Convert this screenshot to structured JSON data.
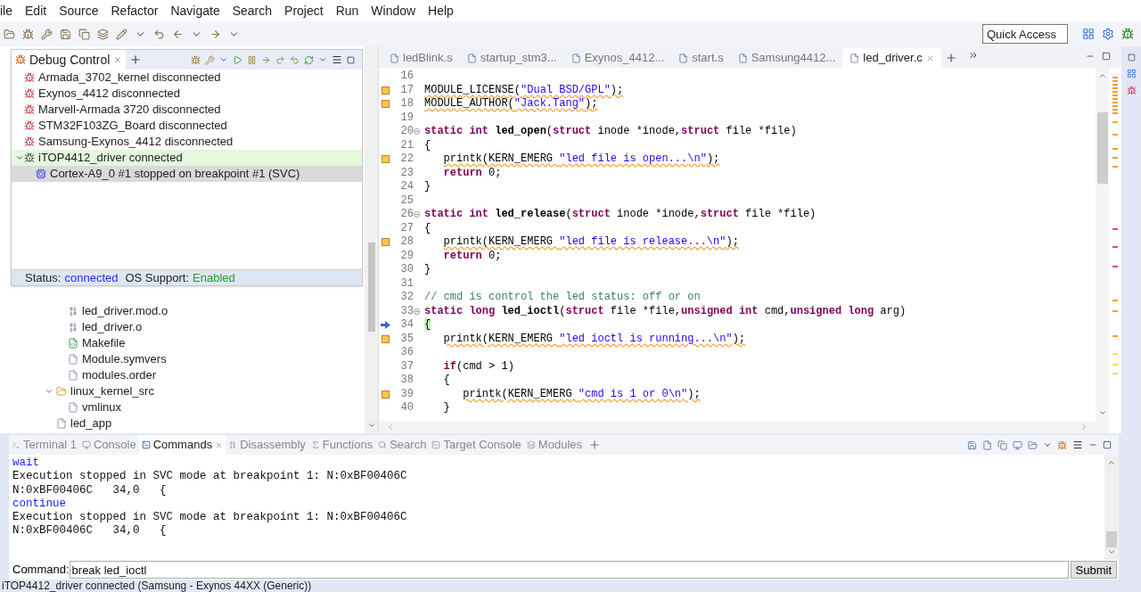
{
  "menu_bar": [
    "ile",
    "Edit",
    "Source",
    "Refactor",
    "Navigate",
    "Search",
    "Project",
    "Run",
    "Window",
    "Help"
  ],
  "quick_access": {
    "placeholder": "Quick Access"
  },
  "debug_control": {
    "tab": {
      "label": "Debug Control",
      "selected": true
    },
    "targets": [
      {
        "label": "Armada_3702_kernel disconnected",
        "connected": false
      },
      {
        "label": "Exynos_4412 disconnected",
        "connected": false
      },
      {
        "label": "Marvell-Armada 3720 disconnected",
        "connected": false
      },
      {
        "label": "STM32F103ZG_Board disconnected",
        "connected": false
      },
      {
        "label": "Samsung-Exynos_4412 disconnected",
        "connected": false
      },
      {
        "label": "iTOP4412_driver connected",
        "connected": true,
        "expanded": true,
        "children": [
          {
            "label": "Cortex-A9_0 #1 stopped on breakpoint #1 (SVC)",
            "selected": true
          }
        ]
      }
    ],
    "status": {
      "label": "Status:",
      "value": "connected",
      "os_label": "OS Support:",
      "os_value": "Enabled"
    }
  },
  "project_tree": [
    {
      "children": [
        {
          "label": "led_driver.mod.o",
          "kind": "object"
        },
        {
          "label": "led_driver.o",
          "kind": "object"
        },
        {
          "label": "Makefile",
          "kind": "makefile"
        },
        {
          "label": "Module.symvers",
          "kind": "file"
        },
        {
          "label": "modules.order",
          "kind": "file"
        }
      ]
    },
    {
      "label": "linux_kernel_src",
      "kind": "folder",
      "expanded": true,
      "children": [
        {
          "label": "vmlinux",
          "kind": "file"
        }
      ]
    },
    {
      "label": "led_app",
      "kind": "file"
    }
  ],
  "editor_tabs": [
    {
      "label": "ledBlink.s",
      "selected": false
    },
    {
      "label": "startup_stm3...",
      "selected": false
    },
    {
      "label": "Exynos_4412...",
      "selected": false
    },
    {
      "label": "start.s",
      "selected": false
    },
    {
      "label": "Samsung4412...",
      "selected": false
    },
    {
      "label": "led_driver.c",
      "selected": true
    }
  ],
  "code_lines": [
    {
      "number": "16"
    },
    {
      "number": "17",
      "warning": true,
      "segments": [
        {
          "kind": "plain",
          "text": "MODULE_LICENSE("
        },
        {
          "kind": "string",
          "text": "\"Dual BSD/GPL\""
        },
        {
          "kind": "plain",
          "text": ");"
        }
      ]
    },
    {
      "number": "18",
      "warning": true,
      "segments": [
        {
          "kind": "plain",
          "text": "MODULE_AUTHOR("
        },
        {
          "kind": "string",
          "text": "\"Jack.Tang\""
        },
        {
          "kind": "plain",
          "text": ");"
        }
      ]
    },
    {
      "number": "19"
    },
    {
      "number": "20",
      "fold": true,
      "segments": [
        {
          "kind": "keyword",
          "text": "static int"
        },
        {
          "kind": "function",
          "text": " led_open"
        },
        {
          "kind": "plain",
          "text": "("
        },
        {
          "kind": "keyword",
          "text": "struct"
        },
        {
          "kind": "plain",
          "text": " inode *inode,"
        },
        {
          "kind": "keyword",
          "text": "struct"
        },
        {
          "kind": "plain",
          "text": " file *file)"
        }
      ]
    },
    {
      "number": "21",
      "segments": [
        {
          "kind": "plain",
          "text": "{"
        }
      ]
    },
    {
      "number": "22",
      "warning": true,
      "segments": [
        {
          "kind": "plain",
          "text": "   printk(KERN_EMERG "
        },
        {
          "kind": "string",
          "text": "\"led file is open...\\n\""
        },
        {
          "kind": "plain",
          "text": ");"
        }
      ]
    },
    {
      "number": "23",
      "segments": [
        {
          "kind": "keyword",
          "text": "   return"
        },
        {
          "kind": "plain",
          "text": " 0;"
        }
      ]
    },
    {
      "number": "24",
      "segments": [
        {
          "kind": "plain",
          "text": "}"
        }
      ]
    },
    {
      "number": "25"
    },
    {
      "number": "26",
      "fold": true,
      "segments": [
        {
          "kind": "keyword",
          "text": "static int"
        },
        {
          "kind": "function",
          "text": " led_release"
        },
        {
          "kind": "plain",
          "text": "("
        },
        {
          "kind": "keyword",
          "text": "struct"
        },
        {
          "kind": "plain",
          "text": " inode *inode,"
        },
        {
          "kind": "keyword",
          "text": "struct"
        },
        {
          "kind": "plain",
          "text": " file *file)"
        }
      ]
    },
    {
      "number": "27",
      "segments": [
        {
          "kind": "plain",
          "text": "{"
        }
      ]
    },
    {
      "number": "28",
      "warning": true,
      "segments": [
        {
          "kind": "plain",
          "text": "   printk(KERN_EMERG "
        },
        {
          "kind": "string",
          "text": "\"led file is release...\\n\""
        },
        {
          "kind": "plain",
          "text": ");"
        }
      ]
    },
    {
      "number": "29",
      "segments": [
        {
          "kind": "keyword",
          "text": "   return"
        },
        {
          "kind": "plain",
          "text": " 0;"
        }
      ]
    },
    {
      "number": "30",
      "segments": [
        {
          "kind": "plain",
          "text": "}"
        }
      ]
    },
    {
      "number": "31"
    },
    {
      "number": "32",
      "segments": [
        {
          "kind": "comment",
          "text": "// cmd is control the led status: off or on"
        }
      ]
    },
    {
      "number": "33",
      "fold": true,
      "segments": [
        {
          "kind": "keyword",
          "text": "static long"
        },
        {
          "kind": "function",
          "text": " led_ioctl"
        },
        {
          "kind": "plain",
          "text": "("
        },
        {
          "kind": "keyword",
          "text": "struct"
        },
        {
          "kind": "plain",
          "text": " file *file,"
        },
        {
          "kind": "keyword",
          "text": "unsigned int"
        },
        {
          "kind": "plain",
          "text": " cmd,"
        },
        {
          "kind": "keyword",
          "text": "unsigned long"
        },
        {
          "kind": "plain",
          "text": " arg)"
        }
      ]
    },
    {
      "number": "34",
      "current": true,
      "segments": [
        {
          "kind": "plain",
          "text": "{"
        }
      ]
    },
    {
      "number": "35",
      "warning": true,
      "segments": [
        {
          "kind": "plain",
          "text": "   printk(KERN_EMERG "
        },
        {
          "kind": "string",
          "text": "\"led ioctl is running...\\n\""
        },
        {
          "kind": "plain",
          "text": ");"
        }
      ]
    },
    {
      "number": "36"
    },
    {
      "number": "37",
      "segments": [
        {
          "kind": "keyword",
          "text": "   if"
        },
        {
          "kind": "plain",
          "text": "(cmd > 1)"
        }
      ]
    },
    {
      "number": "38",
      "segments": [
        {
          "kind": "plain",
          "text": "   {"
        }
      ]
    },
    {
      "number": "39",
      "warning": true,
      "segments": [
        {
          "kind": "plain",
          "text": "      printk(KERN_EMERG "
        },
        {
          "kind": "string",
          "text": "\"cmd is 1 or 0\\n\""
        },
        {
          "kind": "plain",
          "text": ");"
        }
      ]
    },
    {
      "number": "40",
      "segments": [
        {
          "kind": "plain",
          "text": "   }"
        }
      ]
    }
  ],
  "bottom_tabs": [
    {
      "label": "Terminal 1",
      "selected": false
    },
    {
      "label": "Console",
      "selected": false
    },
    {
      "label": "Commands",
      "selected": true
    },
    {
      "label": "Disassembly",
      "selected": false
    },
    {
      "label": "Functions",
      "selected": false
    },
    {
      "label": "Search",
      "selected": false
    },
    {
      "label": "Target Console",
      "selected": false
    },
    {
      "label": "Modules",
      "selected": false
    }
  ],
  "console_lines": [
    {
      "kind": "command",
      "text": "wait"
    },
    {
      "kind": "output",
      "text": "Execution stopped in SVC mode at breakpoint 1: N:0xBF00406C"
    },
    {
      "kind": "output",
      "text": "N:0xBF00406C   34,0   {"
    },
    {
      "kind": "command",
      "text": "continue"
    },
    {
      "kind": "output",
      "text": "Execution stopped in SVC mode at breakpoint 1: N:0xBF00406C"
    },
    {
      "kind": "output",
      "text": "N:0xBF00406C   34,0   {"
    }
  ],
  "command": {
    "label": "Command:",
    "value": "break led_ioctl",
    "button": "Submit"
  },
  "status_bar": "iTOP4412_driver connected (Samsung - Exynos 44XX (Generic))"
}
